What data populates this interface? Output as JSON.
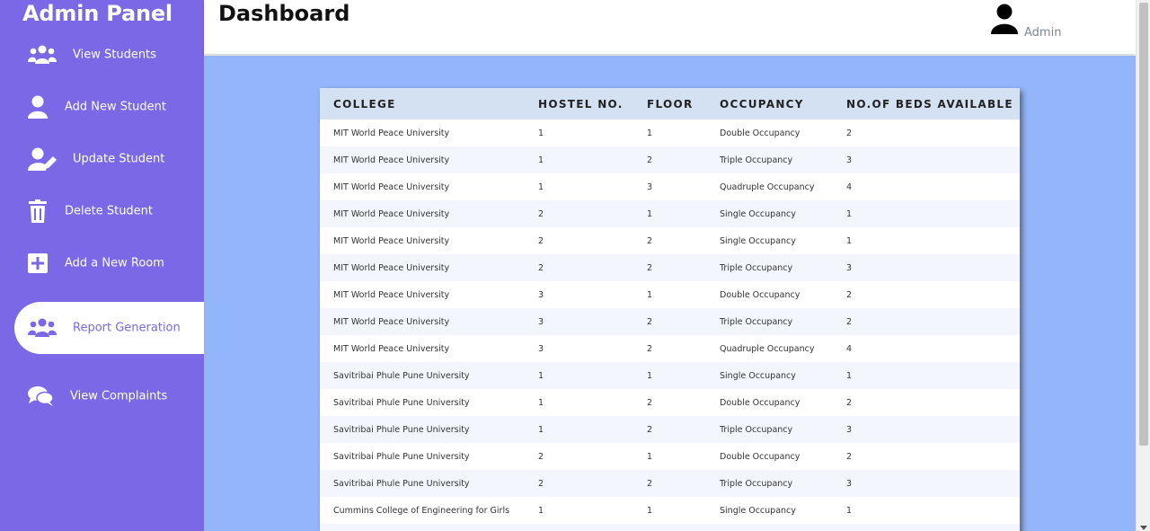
{
  "sidebar": {
    "brand": "Admin Panel",
    "items": [
      {
        "label": "View Students",
        "icon": "users-icon"
      },
      {
        "label": "Add New Student",
        "icon": "user-icon"
      },
      {
        "label": "Update Student",
        "icon": "user-edit-icon"
      },
      {
        "label": "Delete Student",
        "icon": "trash-icon"
      },
      {
        "label": "Add a New Room",
        "icon": "plus-square-icon"
      },
      {
        "label": "Report Generation",
        "icon": "users-icon",
        "active": true
      },
      {
        "label": "View Complaints",
        "icon": "comments-icon"
      }
    ]
  },
  "header": {
    "title": "Dashboard",
    "user_name": "Admin",
    "user_icon": "user-icon"
  },
  "table": {
    "columns": [
      "COLLEGE",
      "HOSTEL NO.",
      "FLOOR",
      "OCCUPANCY",
      "NO.OF BEDS AVAILABLE"
    ],
    "rows": [
      [
        "MIT World Peace University",
        "1",
        "1",
        "Double Occupancy",
        "2"
      ],
      [
        "MIT World Peace University",
        "1",
        "2",
        "Triple Occupancy",
        "3"
      ],
      [
        "MIT World Peace University",
        "1",
        "3",
        "Quadruple Occupancy",
        "4"
      ],
      [
        "MIT World Peace University",
        "2",
        "1",
        "Single Occupancy",
        "1"
      ],
      [
        "MIT World Peace University",
        "2",
        "2",
        "Single Occupancy",
        "1"
      ],
      [
        "MIT World Peace University",
        "2",
        "2",
        "Triple Occupancy",
        "3"
      ],
      [
        "MIT World Peace University",
        "3",
        "1",
        "Double Occupancy",
        "2"
      ],
      [
        "MIT World Peace University",
        "3",
        "2",
        "Triple Occupancy",
        "2"
      ],
      [
        "MIT World Peace University",
        "3",
        "2",
        "Quadruple Occupancy",
        "4"
      ],
      [
        "Savitribai Phule Pune University",
        "1",
        "1",
        "Single Occupancy",
        "1"
      ],
      [
        "Savitribai Phule Pune University",
        "1",
        "2",
        "Double Occupancy",
        "2"
      ],
      [
        "Savitribai Phule Pune University",
        "1",
        "2",
        "Triple Occupancy",
        "3"
      ],
      [
        "Savitribai Phule Pune University",
        "2",
        "1",
        "Double Occupancy",
        "2"
      ],
      [
        "Savitribai Phule Pune University",
        "2",
        "2",
        "Triple Occupancy",
        "3"
      ],
      [
        "Cummins College of Engineering for Girls",
        "1",
        "1",
        "Single Occupancy",
        "1"
      ],
      [
        "",
        "",
        "",
        "",
        ""
      ]
    ]
  },
  "colors": {
    "sidebar": "#7b68e6",
    "main_bg": "#93b6fb",
    "table_header": "#d3e1f3",
    "row_alt": "#f3f7fd"
  }
}
